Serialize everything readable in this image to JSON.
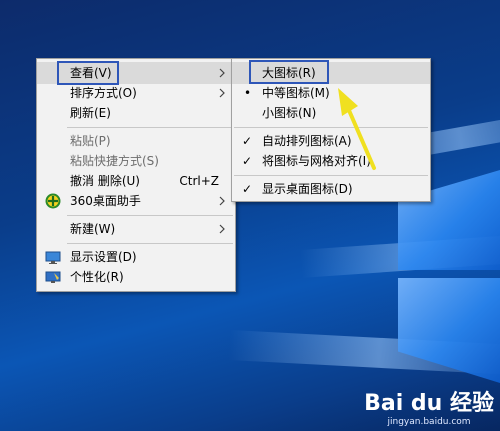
{
  "context_menu": {
    "items": [
      {
        "label": "查看(V)",
        "has_submenu": true,
        "enabled": true
      },
      {
        "label": "排序方式(O)",
        "has_submenu": true,
        "enabled": true
      },
      {
        "label": "刷新(E)",
        "enabled": true
      },
      {
        "label": "粘贴(P)",
        "enabled": false
      },
      {
        "label": "粘贴快捷方式(S)",
        "enabled": false
      },
      {
        "label": "撤消 删除(U)",
        "shortcut": "Ctrl+Z",
        "enabled": true
      },
      {
        "label": "360桌面助手",
        "has_submenu": true,
        "icon": "360-assistant-icon",
        "enabled": true
      },
      {
        "label": "新建(W)",
        "has_submenu": true,
        "enabled": true
      },
      {
        "label": "显示设置(D)",
        "icon": "display-settings-icon",
        "enabled": true
      },
      {
        "label": "个性化(R)",
        "icon": "personalize-icon",
        "enabled": true
      }
    ]
  },
  "view_submenu": {
    "items": [
      {
        "label": "大图标(R)",
        "mark": ""
      },
      {
        "label": "中等图标(M)",
        "mark": "•"
      },
      {
        "label": "小图标(N)",
        "mark": ""
      },
      {
        "label": "自动排列图标(A)",
        "mark": "✓"
      },
      {
        "label": "将图标与网格对齐(I)",
        "mark": "✓"
      },
      {
        "label": "显示桌面图标(D)",
        "mark": "✓"
      }
    ]
  },
  "annotation": {
    "arrow_color": "#f0e020",
    "highlight_color": "#2e56b8"
  },
  "watermark": {
    "brand": "Bai du 经验",
    "url": "jingyan.baidu.com"
  },
  "colors": {
    "menu_bg": "#f2f2f2",
    "hover_bg": "#dadada",
    "disabled_text": "#6d6d6d"
  }
}
